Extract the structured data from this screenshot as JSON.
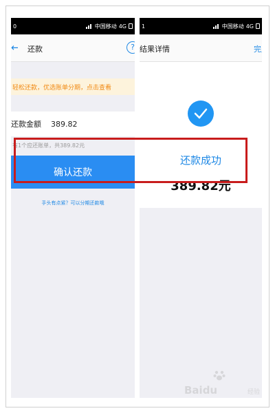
{
  "left": {
    "status": {
      "time": "0",
      "carrier": "中国移动",
      "network": "4G"
    },
    "nav": {
      "back_icon": "back-arrow-icon",
      "title": "还款",
      "help_icon": "?"
    },
    "banner": "轻松还款，优选账单分期，点击查看",
    "amount": {
      "label": "还款金额",
      "value": "389.82"
    },
    "bill_hint": "有1个应还账单，共389.82元",
    "confirm_label": "确认还款",
    "installment_link": "手头有点紧？可以分期还款哦"
  },
  "right": {
    "status": {
      "time": "1",
      "carrier": "中国移动",
      "network": "4G"
    },
    "nav": {
      "title": "结果详情",
      "done": "完成"
    },
    "check_icon": "checkmark-icon",
    "result_text": "还款成功",
    "result_amount": "389.82元"
  },
  "watermark": {
    "text": "Baidu",
    "sub": "经验"
  },
  "colors": {
    "accent": "#2a8df2",
    "highlight": "#c81c1c",
    "banner_text": "#f18a14"
  }
}
